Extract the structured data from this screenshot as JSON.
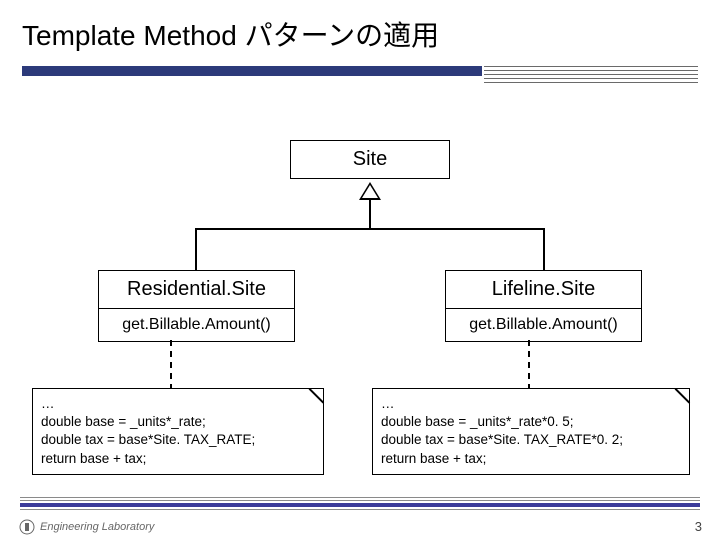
{
  "title": "Template Method パターンの適用",
  "classes": {
    "parent": {
      "name": "Site"
    },
    "left": {
      "name": "Residential.Site",
      "method": "get.Billable.Amount()"
    },
    "right": {
      "name": "Lifeline.Site",
      "method": "get.Billable.Amount()"
    }
  },
  "notes": {
    "left": {
      "lines": [
        "…",
        "double base = _units*_rate;",
        "double tax = base*Site. TAX_RATE;",
        "return base + tax;"
      ]
    },
    "right": {
      "lines": [
        "…",
        "double base = _units*_rate*0. 5;",
        "double tax = base*Site. TAX_RATE*0. 2;",
        "return base + tax;"
      ]
    }
  },
  "slide_number": "3",
  "logo_text": "Engineering Laboratory"
}
